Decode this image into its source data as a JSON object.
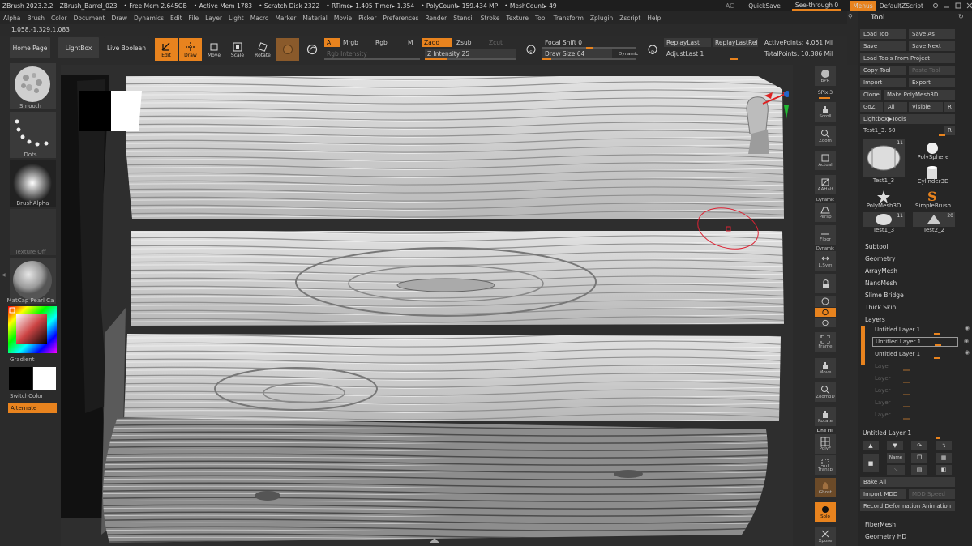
{
  "titlebar": {
    "app": "ZBrush 2023.2.2",
    "document": "ZBrush_Barrel_023",
    "free_mem": "• Free Mem 2.645GB",
    "active_mem": "• Active Mem 1783",
    "scratch_disk": "• Scratch Disk 2322",
    "rtime": "• RTime▸ 1.405 Timer▸ 1.354",
    "polycount": "• PolyCount▸ 159.434 MP",
    "meshcount": "• MeshCount▸ 49",
    "ac": "AC",
    "quicksave": "QuickSave",
    "seethrough": "See-through  0",
    "menus": "Menus",
    "zscript": "DefaultZScript"
  },
  "menubar": [
    "Alpha",
    "Brush",
    "Color",
    "Document",
    "Draw",
    "Dynamics",
    "Edit",
    "File",
    "Layer",
    "Light",
    "Macro",
    "Marker",
    "Material",
    "Movie",
    "Picker",
    "Preferences",
    "Render",
    "Stencil",
    "Stroke",
    "Texture",
    "Tool",
    "Transform",
    "Zplugin",
    "Zscript",
    "Help"
  ],
  "coords": "1.058,-1.329,1.083",
  "toolbar": {
    "home_page": "Home Page",
    "lightbox": "LightBox",
    "live_boolean": "Live Boolean",
    "edit": "Edit",
    "draw": "Draw",
    "move": "Move",
    "scale": "Scale",
    "rotate": "Rotate",
    "a": "A",
    "mrgb": "Mrgb",
    "rgb": "Rgb",
    "m": "M",
    "rgb_intensity": "Rgb Intensity",
    "zadd": "Zadd",
    "zsub": "Zsub",
    "zcut": "Zcut",
    "z_intensity": "Z Intensity 25",
    "focal_shift": "Focal Shift 0",
    "draw_size": "Draw Size 64",
    "dynamic": "Dynamic",
    "replay_last": "ReplayLast",
    "replay_last_rel": "ReplayLastRel",
    "adjust_last": "AdjustLast 1",
    "active_points": "ActivePoints: 4.051 Mil",
    "total_points": "TotalPoints: 10.386 Mil",
    "z_intensity_value": 25,
    "draw_size_value": 64,
    "focal_shift_value": 0
  },
  "leftpanel": {
    "smooth": "Smooth",
    "dots": "Dots",
    "brush_alpha": "~BrushAlpha",
    "texture_off": "Texture Off",
    "matcap": "MatCap Pearl Ca",
    "gradient": "Gradient",
    "switchcolor": "SwitchColor",
    "alternate": "Alternate"
  },
  "rightshelf": {
    "bpr": "BPR",
    "spix": "SPix 3",
    "scroll": "Scroll",
    "zoom": "Zoom",
    "actual": "Actual",
    "aahalf": "AAHalf",
    "dynamic": "Dynamic",
    "persp": "Persp",
    "floor": "Floor",
    "lsym": "L.Sym",
    "frame": "Frame",
    "move": "Move",
    "zoom3d": "Zoom3D",
    "rotate": "Rotate",
    "line_fill": "Line Fill",
    "polyf": "PolyF",
    "transp": "Transp",
    "ghost": "Ghost",
    "solo": "Solo",
    "xpose": "Xpose"
  },
  "toolpanel": {
    "title": "Tool",
    "load_tool": "Load Tool",
    "save_as": "Save As",
    "save": "Save",
    "save_next": "Save Next",
    "load_from_project": "Load Tools From Project",
    "copy_tool": "Copy Tool",
    "paste_tool": "Paste Tool",
    "import": "Import",
    "export": "Export",
    "clone": "Clone",
    "make_polymesh": "Make PolyMesh3D",
    "goz": "GoZ",
    "all": "All",
    "visible": "Visible",
    "r": "R",
    "lightbox_tools": "Lightbox▶Tools",
    "current_tool": "Test1_3. 50",
    "thumbs": [
      {
        "label": "Test1_3",
        "badge": "11"
      },
      {
        "label": "PolySphere",
        "badge": ""
      },
      {
        "label": "Cylinder3D",
        "badge": ""
      },
      {
        "label": "PolyMesh3D",
        "badge": ""
      },
      {
        "label": "SimpleBrush",
        "badge": ""
      },
      {
        "label": "Test1_3",
        "badge": "11"
      },
      {
        "label": "Test2_2",
        "badge": "20"
      }
    ],
    "sections": [
      "Subtool",
      "Geometry",
      "ArrayMesh",
      "NanoMesh",
      "Slime Bridge",
      "Thick Skin",
      "Layers"
    ],
    "layers": [
      {
        "name": "Untitled Layer 1",
        "active": true
      },
      {
        "name": "Untitled Layer 1",
        "active": true
      },
      {
        "name": "Untitled Layer 1",
        "active": true
      },
      {
        "name": "Layer",
        "active": false
      },
      {
        "name": "Layer",
        "active": false
      },
      {
        "name": "Layer",
        "active": false
      },
      {
        "name": "Layer",
        "active": false
      },
      {
        "name": "Layer",
        "active": false
      }
    ],
    "current_layer": "Untitled Layer 1",
    "name_btn": "Name",
    "bake_all": "Bake All",
    "import_mdd": "Import MDD",
    "mdd_speed": "MDD Speed",
    "record_deformation": "Record Deformation Animation",
    "fibermesh": "FiberMesh",
    "geometry_hd": "Geometry HD"
  },
  "colors": {
    "accent": "#e8831e",
    "panel": "#2b2b2b",
    "button": "#3a3a3a"
  }
}
